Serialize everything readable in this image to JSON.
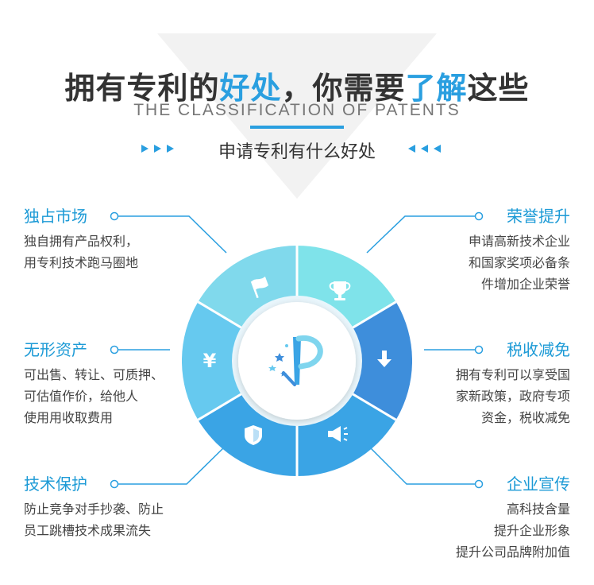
{
  "title": {
    "part1": "拥有专利的",
    "part2": "好处",
    "part3": "，你需要",
    "part4": "了解",
    "part5": "这些"
  },
  "subtitle": "THE CLASSIFICATION OF PATENTS",
  "tagline": "申请专利有什么好处",
  "colors": {
    "accent": "#2a9fe0",
    "heading": "#1c9ad6",
    "segment_light": "#7fe3ea",
    "segment_mid": "#66c9ef",
    "segment_blue": "#3aa4e5",
    "segment_dark": "#3e8edb"
  },
  "features": [
    {
      "title": "独占市场",
      "lines": [
        "独自拥有产品权利，",
        "用专利技术跑马圈地"
      ]
    },
    {
      "title": "无形资产",
      "lines": [
        "可出售、转让、可质押、",
        "可估值作价，给他人",
        "使用用收取费用"
      ]
    },
    {
      "title": "技术保护",
      "lines": [
        "防止竞争对手抄袭、防止",
        "员工跳槽技术成果流失"
      ]
    },
    {
      "title": "荣誉提升",
      "lines": [
        "申请高新技术企业",
        "和国家奖项必备条",
        "件增加企业荣誉"
      ]
    },
    {
      "title": "税收减免",
      "lines": [
        "拥有专利可以享受国",
        "家新政策，政府专项",
        "资金，税收减免"
      ]
    },
    {
      "title": "企业宣传",
      "lines": [
        "高科技含量",
        "提升企业形象",
        "提升公司品牌附加值"
      ]
    }
  ],
  "icons": [
    "flag-icon",
    "trophy-icon",
    "download-arrow-icon",
    "megaphone-icon",
    "shield-icon",
    "yen-icon",
    "patent-logo-icon"
  ]
}
